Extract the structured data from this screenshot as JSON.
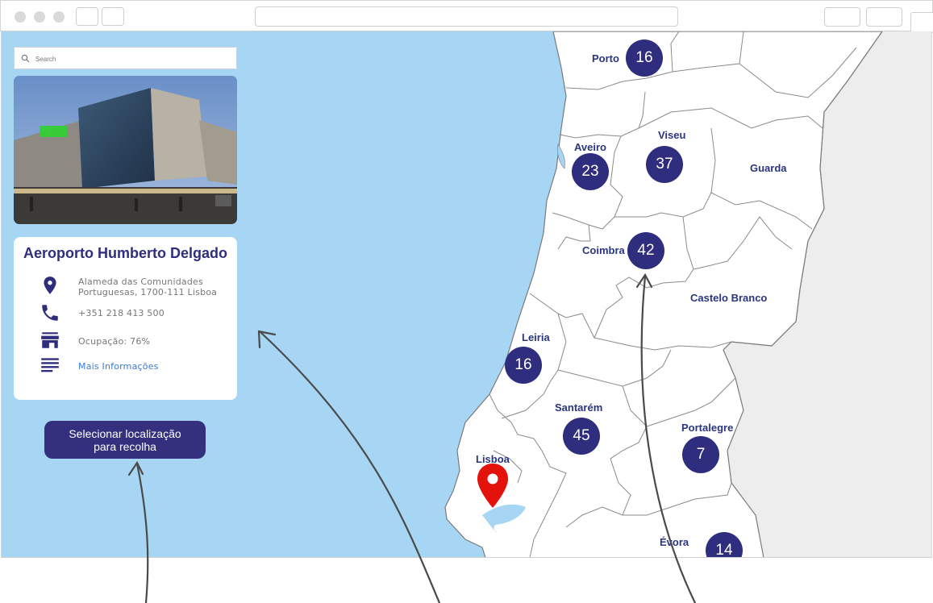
{
  "search": {
    "placeholder": "Search"
  },
  "location": {
    "name": "Aeroporto Humberto Delgado",
    "address_line1": "Alameda das Comunidades",
    "address_line2": "Portuguesas, 1700-111 Lisboa",
    "phone": "+351 218 413 500",
    "occupancy": "Ocupação: 76%",
    "more_info": "Mais Informações"
  },
  "select_button": {
    "line1": "Selecionar localização",
    "line2": "para recolha"
  },
  "districts": [
    {
      "name": "Porto",
      "count": "16"
    },
    {
      "name": "Aveiro",
      "count": "23"
    },
    {
      "name": "Viseu",
      "count": "37"
    },
    {
      "name": "Guarda",
      "count": ""
    },
    {
      "name": "Coimbra",
      "count": "42"
    },
    {
      "name": "Castelo Branco",
      "count": ""
    },
    {
      "name": "Leiria",
      "count": "16"
    },
    {
      "name": "Santarém",
      "count": "45"
    },
    {
      "name": "Portalegre",
      "count": "7"
    },
    {
      "name": "Lisboa",
      "count": ""
    },
    {
      "name": "Évora",
      "count": "14"
    }
  ],
  "colors": {
    "sea": "#a7d6f5",
    "land": "#ffffff",
    "spain": "#ededed",
    "cluster": "#2f2d7d",
    "pin": "#e3120b",
    "button": "#34307d",
    "accent_link": "#3a7bd5"
  },
  "icons": [
    "search-icon",
    "map-pin-icon",
    "phone-icon",
    "store-icon",
    "notes-icon",
    "location-marker-icon"
  ]
}
